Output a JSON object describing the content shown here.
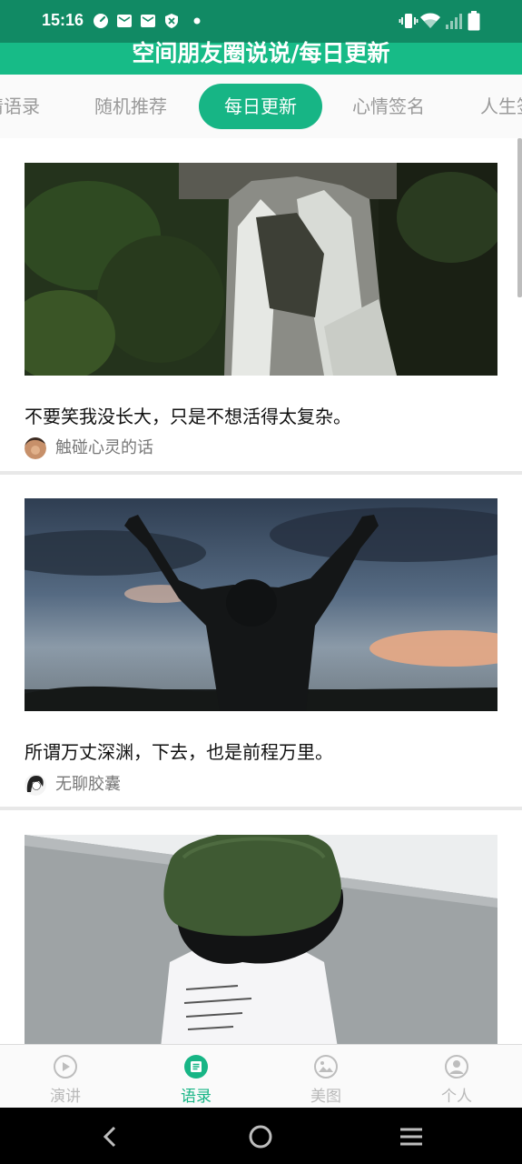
{
  "status_bar": {
    "time": "15:16",
    "left_icons": [
      "speedometer-icon",
      "mail-icon",
      "mail-icon",
      "vpn-shield-icon",
      "dot-icon"
    ],
    "right_icons": [
      "vibrate-icon",
      "wifi-icon",
      "signal-icon",
      "battery-icon"
    ],
    "background": "#118a64"
  },
  "header": {
    "title": "空间朋友圈说说/每日更新",
    "background": "#17bb87"
  },
  "tabs": [
    {
      "label": "情语录",
      "active": false
    },
    {
      "label": "随机推荐",
      "active": false
    },
    {
      "label": "每日更新",
      "active": true
    },
    {
      "label": "心情签名",
      "active": false
    },
    {
      "label": "人生签",
      "active": false
    }
  ],
  "accent_color": "#17b585",
  "posts": [
    {
      "image": "waterfall-photo",
      "text": "不要笑我没长大，只是不想活得太复杂。",
      "author": "触碰心灵的话"
    },
    {
      "image": "raised-arms-sunset-photo",
      "text": "所谓万丈深渊，下去，也是前程万里。",
      "author": "无聊胶囊"
    },
    {
      "image": "green-hat-girl-photo",
      "text": "",
      "author": ""
    }
  ],
  "bottom_nav": [
    {
      "label": "演讲",
      "icon": "play-circle-icon",
      "active": false
    },
    {
      "label": "语录",
      "icon": "quote-list-icon",
      "active": true
    },
    {
      "label": "美图",
      "icon": "picture-icon",
      "active": false
    },
    {
      "label": "个人",
      "icon": "person-icon",
      "active": false
    }
  ],
  "system_nav": [
    "back-icon",
    "home-icon",
    "recents-icon"
  ]
}
